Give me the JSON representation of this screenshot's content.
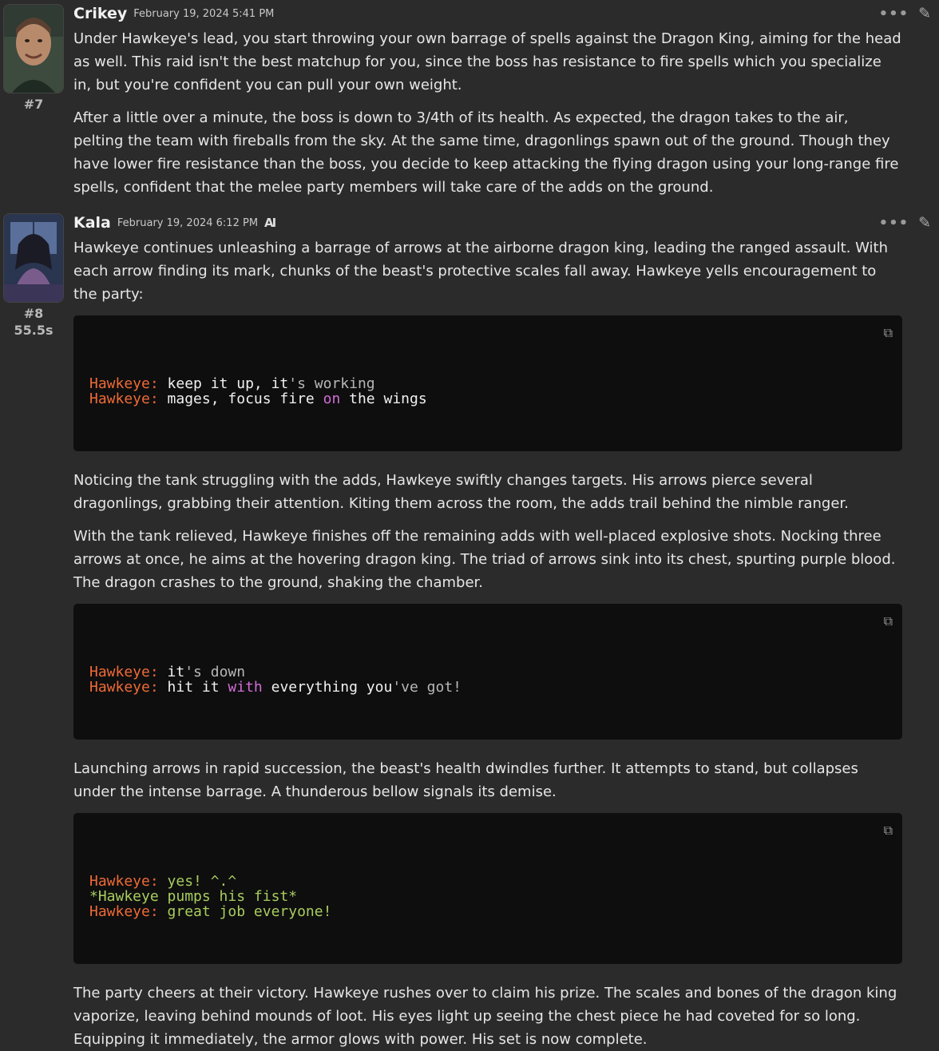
{
  "post1": {
    "author": "Crikey",
    "date": "February 19, 2024 5:41 PM",
    "number": "#7",
    "paragraphs": [
      "Under Hawkeye's lead, you start throwing your own barrage of spells against the Dragon King, aiming for the head as well. This raid isn't the best matchup for you, since the boss has resistance to fire spells which you specialize in, but you're confident you can pull your own weight.",
      "After a little over a minute, the boss is down to 3/4th of its health. As expected, the dragon takes to the air, pelting the team with fireballs from the sky. At the same time, dragonlings spawn out of the ground. Though they have lower fire resistance than the boss, you decide to keep attacking the flying dragon using your long-range fire spells, confident that the melee party members will take care of the adds on the ground."
    ]
  },
  "post2": {
    "author": "Kala",
    "date": "February 19, 2024 6:12 PM",
    "ai_badge": "AI",
    "number": "#8",
    "gen_time": "55.5s",
    "p1": "Hawkeye continues unleashing a barrage of arrows at the airborne dragon king, leading the ranged assault. With each arrow finding its mark, chunks of the beast's protective scales fall away. Hawkeye yells encouragement to the party:",
    "code1": [
      [
        [
          "o",
          "Hawkeye:"
        ],
        [
          "w",
          " keep it up, it"
        ],
        [
          "g",
          "'s working"
        ]
      ],
      [
        [
          "o",
          "Hawkeye:"
        ],
        [
          "w",
          " mages, focus fire "
        ],
        [
          "p",
          "on"
        ],
        [
          "w",
          " the wings"
        ]
      ]
    ],
    "p2": "Noticing the tank struggling with the adds, Hawkeye swiftly changes targets. His arrows pierce several dragonlings, grabbing their attention. Kiting them across the room, the adds trail behind the nimble ranger.",
    "p3": "With the tank relieved, Hawkeye finishes off the remaining adds with well-placed explosive shots. Nocking three arrows at once, he aims at the hovering dragon king. The triad of arrows sink into its chest, spurting purple blood. The dragon crashes to the ground, shaking the chamber.",
    "code2": [
      [
        [
          "o",
          "Hawkeye:"
        ],
        [
          "w",
          " it"
        ],
        [
          "g",
          "'s down"
        ]
      ],
      [
        [
          "o",
          "Hawkeye:"
        ],
        [
          "w",
          " hit it "
        ],
        [
          "p",
          "with"
        ],
        [
          "w",
          " everything you"
        ],
        [
          "g",
          "'ve got!"
        ]
      ]
    ],
    "p4": "Launching arrows in rapid succession, the beast's health dwindles further. It attempts to stand, but collapses under the intense barrage. A thunderous bellow signals its demise.",
    "code3": [
      [
        [
          "o",
          "Hawkeye:"
        ],
        [
          "l",
          " yes! ^.^"
        ]
      ],
      [
        [
          "l",
          "*Hawkeye pumps his fist*"
        ]
      ],
      [
        [
          "o",
          "Hawkeye:"
        ],
        [
          "l",
          " great job everyone!"
        ]
      ]
    ],
    "p5": "The party cheers at their victory. Hawkeye rushes over to claim his prize. The scales and bones of the dragon king vaporize, leaving behind mounds of loot. His eyes light up seeing the chest piece he had coveted for so long. Equipping it immediately, the armor glows with power. His set is now complete."
  },
  "icons": {
    "more": "more-options-icon",
    "edit": "edit-pencil-icon",
    "copy": "copy-icon"
  },
  "colors": {
    "background": "#2b2b2b",
    "code_background": "#0e0e0e",
    "speaker_orange": "#ee6a36",
    "keyword_purple": "#d26cd6",
    "action_green": "#a8cc5e"
  }
}
